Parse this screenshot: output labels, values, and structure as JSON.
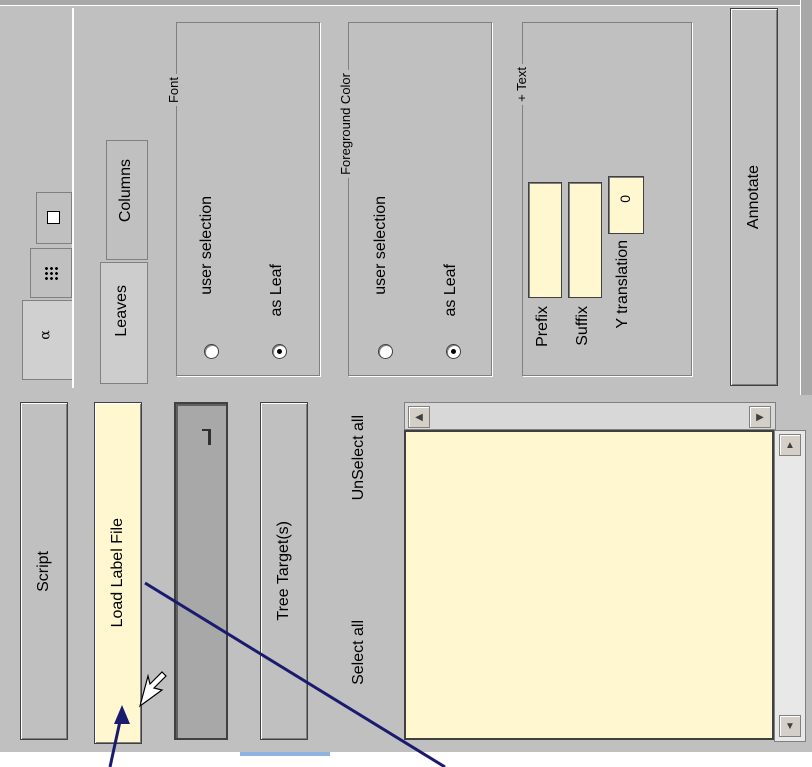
{
  "left_panel": {
    "script_button": "Script",
    "load_label_button": "Load Label File",
    "tree_targets_button": "Tree Target(s)",
    "select_all_link": "Select all",
    "unselect_all_link": "UnSelect all"
  },
  "tabs": {
    "tab1_icon": "alpha-icon",
    "tab2_icon": "grid-icon",
    "tab3_icon": "chart-icon",
    "sub_tabs": [
      "Leaves",
      "Columns"
    ]
  },
  "font_group": {
    "title": "Font",
    "options": [
      "user selection",
      "as Leaf"
    ],
    "selected": "as Leaf"
  },
  "foreground_group": {
    "title": "Foreground Color",
    "options": [
      "user selection",
      "as Leaf"
    ],
    "selected": "as Leaf"
  },
  "text_group": {
    "title": "+ Text",
    "prefix_label": "Prefix",
    "suffix_label": "Suffix",
    "y_translation_label": "Y translation",
    "prefix_value": "",
    "suffix_value": "",
    "y_translation_value": "0"
  },
  "annotate_button": "Annotate",
  "colors": {
    "panel": "#c0c0c0",
    "field": "#fff7cf",
    "arrow": "#1a1a6e"
  }
}
